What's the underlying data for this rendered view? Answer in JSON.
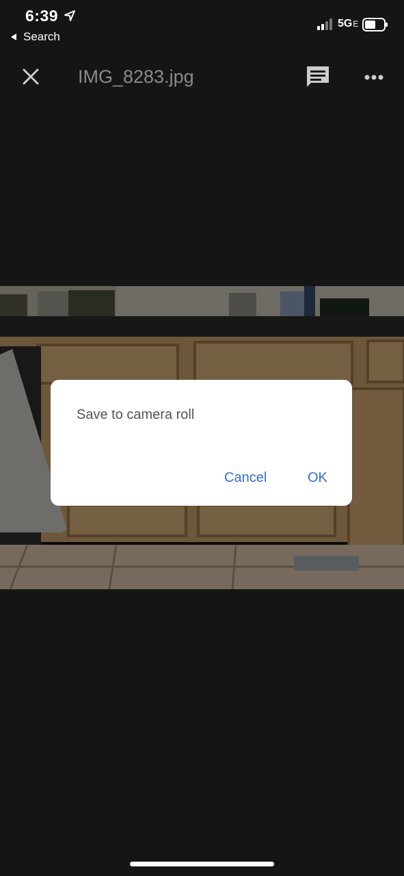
{
  "status_bar": {
    "time": "6:39",
    "back_label": "Search",
    "network": "5G",
    "network_suffix": "E"
  },
  "app_bar": {
    "file_name": "IMG_8283.jpg",
    "close_icon": "close-icon",
    "comment_icon": "comment-icon",
    "more_icon": "more-horizontal-icon"
  },
  "dialog": {
    "message": "Save to camera roll",
    "cancel_label": "Cancel",
    "ok_label": "OK",
    "accent_color": "#2f6fd6"
  }
}
